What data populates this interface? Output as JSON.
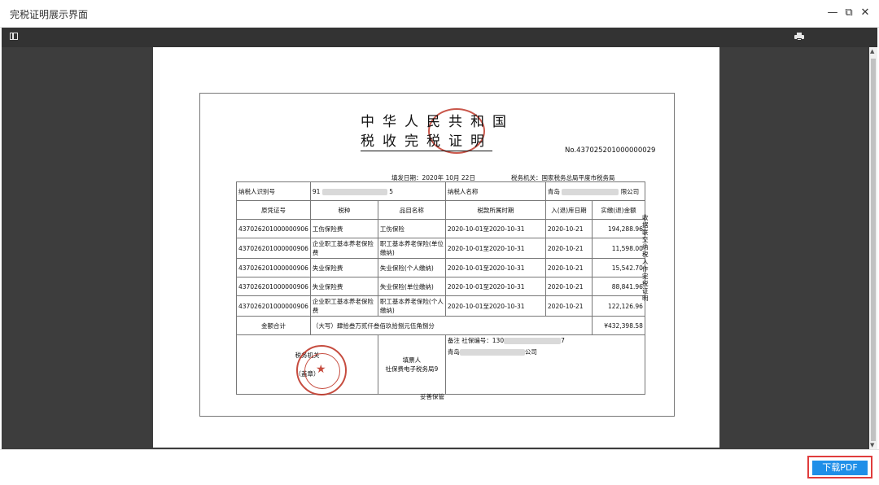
{
  "window": {
    "title": "完税证明展示界面",
    "controls": [
      "—",
      "⧉",
      "✕"
    ]
  },
  "viewer": {
    "sidebar_icon": "sidebar-toggle-icon",
    "print_icon": "printer-icon"
  },
  "certificate": {
    "title_line1": "中华人民共和国",
    "title_line2": "税收完税证明",
    "number": "No.437025201000000029",
    "fill_date": "填发日期：2020年  10月  22日",
    "tax_office": "税务机关：国家税务总局平度市税务局",
    "taxpayer_id_label": "纳税人识别号",
    "taxpayer_id_prefix": "91",
    "taxpayer_id_suffix": "5",
    "taxpayer_name_label": "纳税人名称",
    "taxpayer_name_prefix": "青岛",
    "taxpayer_name_suffix": "限公司",
    "columns": [
      "原凭证号",
      "税种",
      "品目名称",
      "税款所属时期",
      "入(退)库日期",
      "实缴(退)金额"
    ],
    "rows": [
      {
        "voucher": "437026201000000906",
        "tax_type": "工伤保险费",
        "item": "工伤保险",
        "period": "2020-10-01至2020-10-31",
        "date": "2020-10-21",
        "amount": "194,288.96"
      },
      {
        "voucher": "437026201000000906",
        "tax_type": "企业职工基本养老保险费",
        "item": "职工基本养老保险(单位缴纳)",
        "period": "2020-10-01至2020-10-31",
        "date": "2020-10-21",
        "amount": "11,598.00"
      },
      {
        "voucher": "437026201000000906",
        "tax_type": "失业保险费",
        "item": "失业保险(个人缴纳)",
        "period": "2020-10-01至2020-10-31",
        "date": "2020-10-21",
        "amount": "15,542.70"
      },
      {
        "voucher": "437026201000000906",
        "tax_type": "失业保险费",
        "item": "失业保险(单位缴纳)",
        "period": "2020-10-01至2020-10-31",
        "date": "2020-10-21",
        "amount": "88,841.96"
      },
      {
        "voucher": "437026201000000906",
        "tax_type": "企业职工基本养老保险费",
        "item": "职工基本养老保险(个人缴纳)",
        "period": "2020-10-01至2020-10-31",
        "date": "2020-10-21",
        "amount": "122,126.96"
      }
    ],
    "total_label": "金额合计",
    "total_words": "（大写）肆拾叁万贰仟叁佰玖拾捌元伍角捌分",
    "total_amount": "¥432,398.58",
    "tax_office_seal_label": "税务机关",
    "seal_note": "（盖章）",
    "filler_label": "填票人",
    "filler_name": "社保费电子税务局9",
    "remark_prefix": "备注 社保编号：130",
    "remark_suffix": "7",
    "remark_company_prefix": "青岛",
    "remark_company_suffix": "公司",
    "side_text": "收据联交纳税人作完税证明",
    "footer": "妥善保管"
  },
  "download_button": "下载PDF"
}
